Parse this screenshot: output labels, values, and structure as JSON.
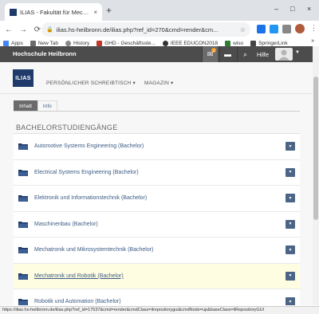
{
  "browser": {
    "tab_title": "ILIAS - Fakultät für Mechanik und",
    "tab_close": "×",
    "new_tab": "+",
    "window_controls": [
      "–",
      "□",
      "×"
    ],
    "url": "ilias.hs-heilbronn.de/ilias.php?ref_id=270&cmd=render&cm...",
    "bookmarks": [
      {
        "label": "Apps",
        "color": "#4285f4"
      },
      {
        "label": "New Tab",
        "color": "#6b6b6b"
      },
      {
        "label": "History",
        "color": "#888888"
      },
      {
        "label": "GHD - Geschäftsste...",
        "color": "#c0392b"
      },
      {
        "label": "IEEE EDUCON2018",
        "color": "#333333"
      },
      {
        "label": "wiso",
        "color": "#2e7d32"
      },
      {
        "label": "SpringerLink",
        "color": "#444444"
      }
    ],
    "bookmarks_more": "»",
    "status_url": "https://ilias.hs-heilbronn.de/ilias.php?ref_id=17537&cmd=render&cmdClass=ilrepositorygui&cmdNode=up&baseClass=ilRepositoryGUI"
  },
  "ilias": {
    "institution": "Hochschule Heilbronn",
    "notification_count": "1",
    "help_label": "Hilfe",
    "logo_text": "ILIAS",
    "menu": [
      "PERSÖNLICHER SCHREIBTISCH",
      "MAGAZIN"
    ],
    "tabs": [
      "Inhalt",
      "Info"
    ],
    "section_title": "BACHELORSTUDIENGÄNGE",
    "items": [
      "Automotive Systems Engineering (Bachelor)",
      "Electrical Systems Engineering (Bachelor)",
      "Elektronik und Informationstechnik (Bachelor)",
      "Maschinenbau (Bachelor)",
      "Mechatronik und Mikrosystemtechnik (Bachelor)",
      "Mechatronik und Robotik (Bachelor)",
      "Robotik und Automation (Bachelor)"
    ],
    "highlighted_index": 5,
    "colors": {
      "topbar": "#4c4c4c",
      "link": "#3b5b84",
      "action": "#4c6586",
      "highlight": "#fffde1",
      "brand": "#1f3a6b"
    }
  }
}
